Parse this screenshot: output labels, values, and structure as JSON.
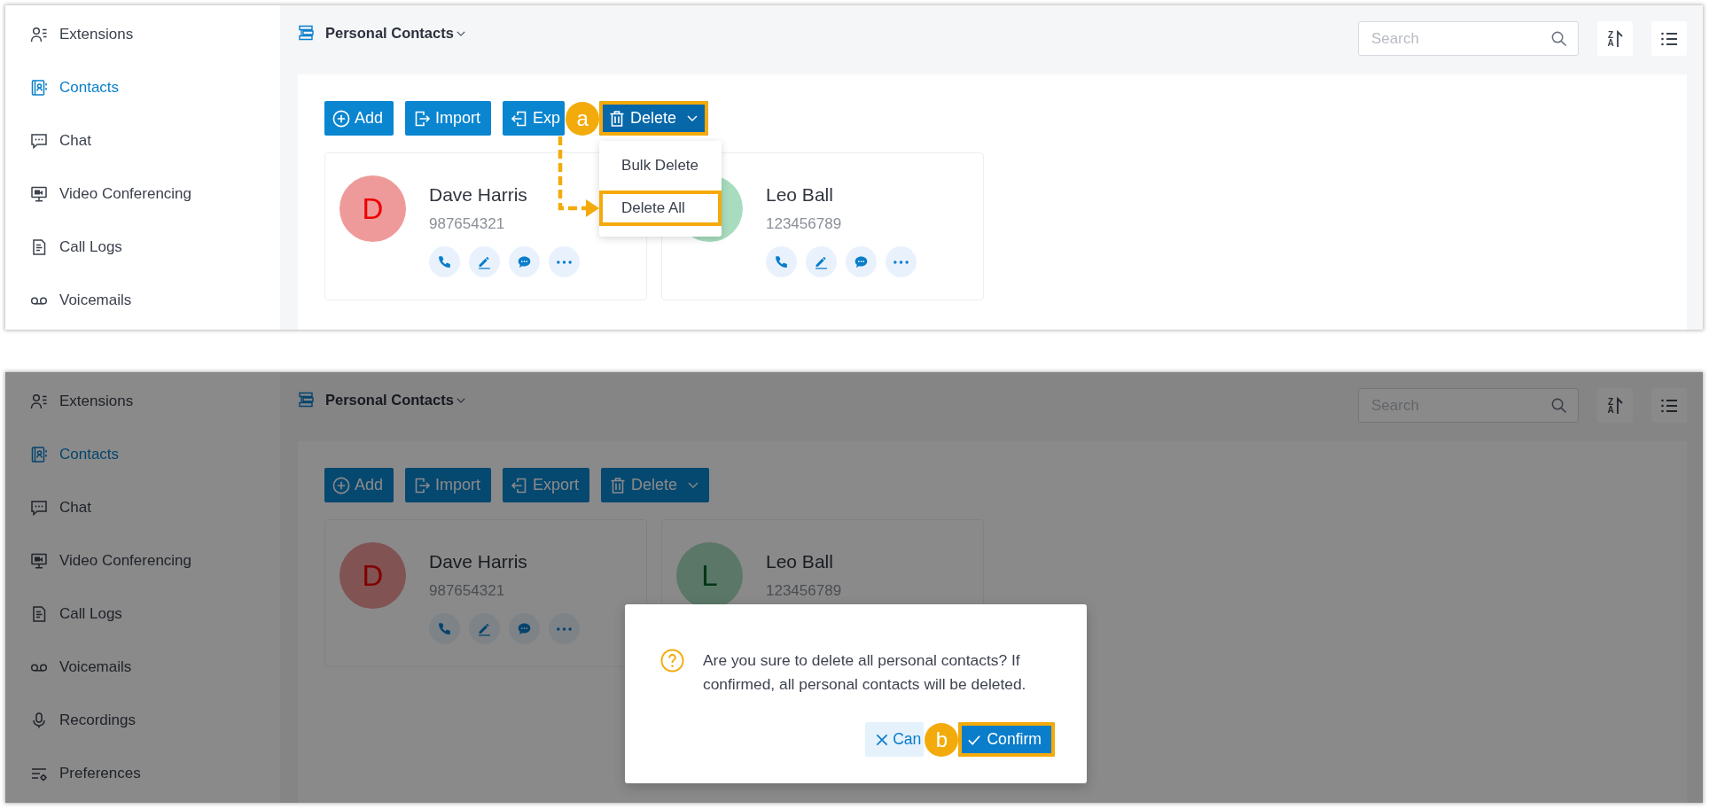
{
  "panels": [
    {
      "sidebar": {
        "items": [
          {
            "label": "Extensions",
            "selected": false
          },
          {
            "label": "Contacts",
            "selected": true
          },
          {
            "label": "Chat",
            "selected": false
          },
          {
            "label": "Video Conferencing",
            "selected": false
          },
          {
            "label": "Call Logs",
            "selected": false
          },
          {
            "label": "Voicemails",
            "selected": false
          }
        ]
      },
      "header": {
        "title": "Personal Contacts",
        "search": {
          "placeholder": "Search"
        },
        "sort_button": {
          "label": "ZA"
        }
      },
      "toolbar": [
        {
          "kind": "button",
          "label": "Add",
          "outlined": false
        },
        {
          "kind": "button",
          "label": "Import",
          "outlined": false
        },
        {
          "kind": "button",
          "label": "Exp",
          "outlined": false,
          "callout": "a"
        },
        {
          "kind": "dropdown",
          "label": "Delete",
          "outlined": true,
          "expanded": true,
          "menu": [
            {
              "label": "Bulk Delete",
              "outlined": false
            },
            {
              "label": "Delete All",
              "outlined": true
            }
          ]
        }
      ],
      "contacts": [
        {
          "initial": "D",
          "name": "Dave Harris",
          "number": "987654321",
          "color": "#ef9a9a",
          "actions_visible": true
        },
        {
          "name": "Leo Ball",
          "number": "123456789",
          "color": "#a8dcbe",
          "actions_visible": true
        }
      ],
      "dimmed": false
    },
    {
      "sidebar": {
        "items": [
          {
            "label": "Extensions",
            "selected": false
          },
          {
            "label": "Contacts",
            "selected": true
          },
          {
            "label": "Chat",
            "selected": false
          },
          {
            "label": "Video Conferencing",
            "selected": false
          },
          {
            "label": "Call Logs",
            "selected": false
          },
          {
            "label": "Voicemails",
            "selected": false
          },
          {
            "label": "Recordings",
            "selected": false
          },
          {
            "label": "Preferences",
            "selected": false
          }
        ]
      },
      "header": {
        "title": "Personal Contacts",
        "search": {
          "placeholder": "Search"
        },
        "sort_button": {
          "label": "ZA"
        }
      },
      "toolbar": [
        {
          "kind": "button",
          "label": "Add",
          "outlined": false
        },
        {
          "kind": "button",
          "label": "Import",
          "outlined": false
        },
        {
          "kind": "button",
          "label": "Export",
          "outlined": false
        },
        {
          "kind": "dropdown",
          "label": "Delete",
          "outlined": false,
          "expanded": false
        }
      ],
      "contacts": [
        {
          "initial": "D",
          "name": "Dave Harris",
          "number": "987654321",
          "color": "#815353",
          "actions_visible": true
        },
        {
          "initial": "L",
          "name": "Leo Ball",
          "number": "123456789",
          "color": "#5b7767"
        }
      ],
      "dimmed": true,
      "dialog": {
        "message": "Are you sure to delete all personal contacts? If confirmed, all personal contacts will be deleted.",
        "buttons": [
          {
            "kind": "secondary",
            "label": "Can",
            "outlined": false,
            "callout": "b"
          },
          {
            "kind": "primary",
            "label": "Confirm",
            "outlined": true
          }
        ]
      }
    }
  ]
}
